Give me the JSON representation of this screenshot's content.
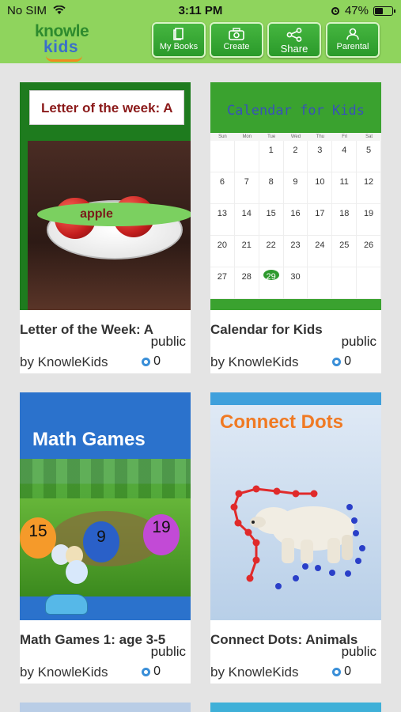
{
  "status_bar": {
    "carrier": "No SIM",
    "time": "3:11 PM",
    "battery": "47%",
    "battery_level": 0.47
  },
  "header": {
    "logo_line1": "knowle",
    "logo_line2": "kids",
    "buttons": [
      {
        "label": "My Books",
        "icon": "book-icon"
      },
      {
        "label": "Create",
        "icon": "camera-icon"
      },
      {
        "label": "Share",
        "icon": "share-icon"
      },
      {
        "label": "Parental",
        "icon": "person-icon"
      }
    ]
  },
  "books": [
    {
      "title": "Letter of the Week: A",
      "visibility": "public",
      "author": "by KnowleKids",
      "likes": "0",
      "cover_banner": "Letter of the week: A",
      "cover_caption": "apple"
    },
    {
      "title": "Calendar for Kids",
      "visibility": "public",
      "author": "by KnowleKids",
      "likes": "0",
      "cover_banner": "Calendar for Kids",
      "cover_dows": [
        "Sun",
        "Mon",
        "Tue",
        "Wed",
        "Thu",
        "Fri",
        "Sat"
      ],
      "cover_days": [
        "",
        "",
        "1",
        "2",
        "3",
        "4",
        "5",
        "6",
        "7",
        "8",
        "9",
        "10",
        "11",
        "12",
        "13",
        "14",
        "15",
        "16",
        "17",
        "18",
        "19",
        "20",
        "21",
        "22",
        "23",
        "24",
        "25",
        "26",
        "27",
        "28",
        "29",
        "30",
        "",
        "",
        ""
      ],
      "highlighted_day": "29"
    },
    {
      "title": "Math Games 1: age 3-5",
      "visibility": "public",
      "author": "by KnowleKids",
      "likes": "0",
      "cover_banner": "Math Games",
      "balloon_numbers": [
        "15",
        "9",
        "19"
      ]
    },
    {
      "title": "Connect Dots: Animals",
      "visibility": "public",
      "author": "by KnowleKids",
      "likes": "0",
      "cover_banner": "Connect Dots"
    }
  ]
}
